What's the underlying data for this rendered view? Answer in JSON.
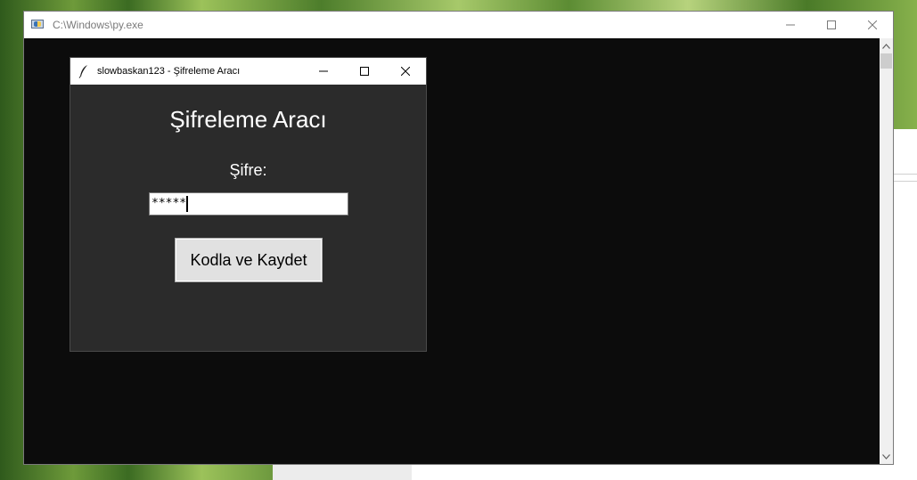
{
  "console_window": {
    "title": "C:\\Windows\\py.exe"
  },
  "app_window": {
    "title": "slowbaskan123 - Şifreleme Aracı",
    "heading": "Şifreleme Aracı",
    "password_label": "Şifre:",
    "password_value": "*****",
    "encode_button_label": "Kodla ve Kaydet"
  },
  "icons": {
    "console_icon": "python-console-icon",
    "app_icon": "tk-feather-icon",
    "minimize": "minimize-icon",
    "maximize": "maximize-icon",
    "close": "close-icon",
    "scroll_up": "chevron-up-icon",
    "scroll_down": "chevron-down-icon"
  },
  "colors": {
    "console_bg": "#0c0c0c",
    "app_bg": "#2b2b2b",
    "button_bg": "#e1e1e1"
  }
}
